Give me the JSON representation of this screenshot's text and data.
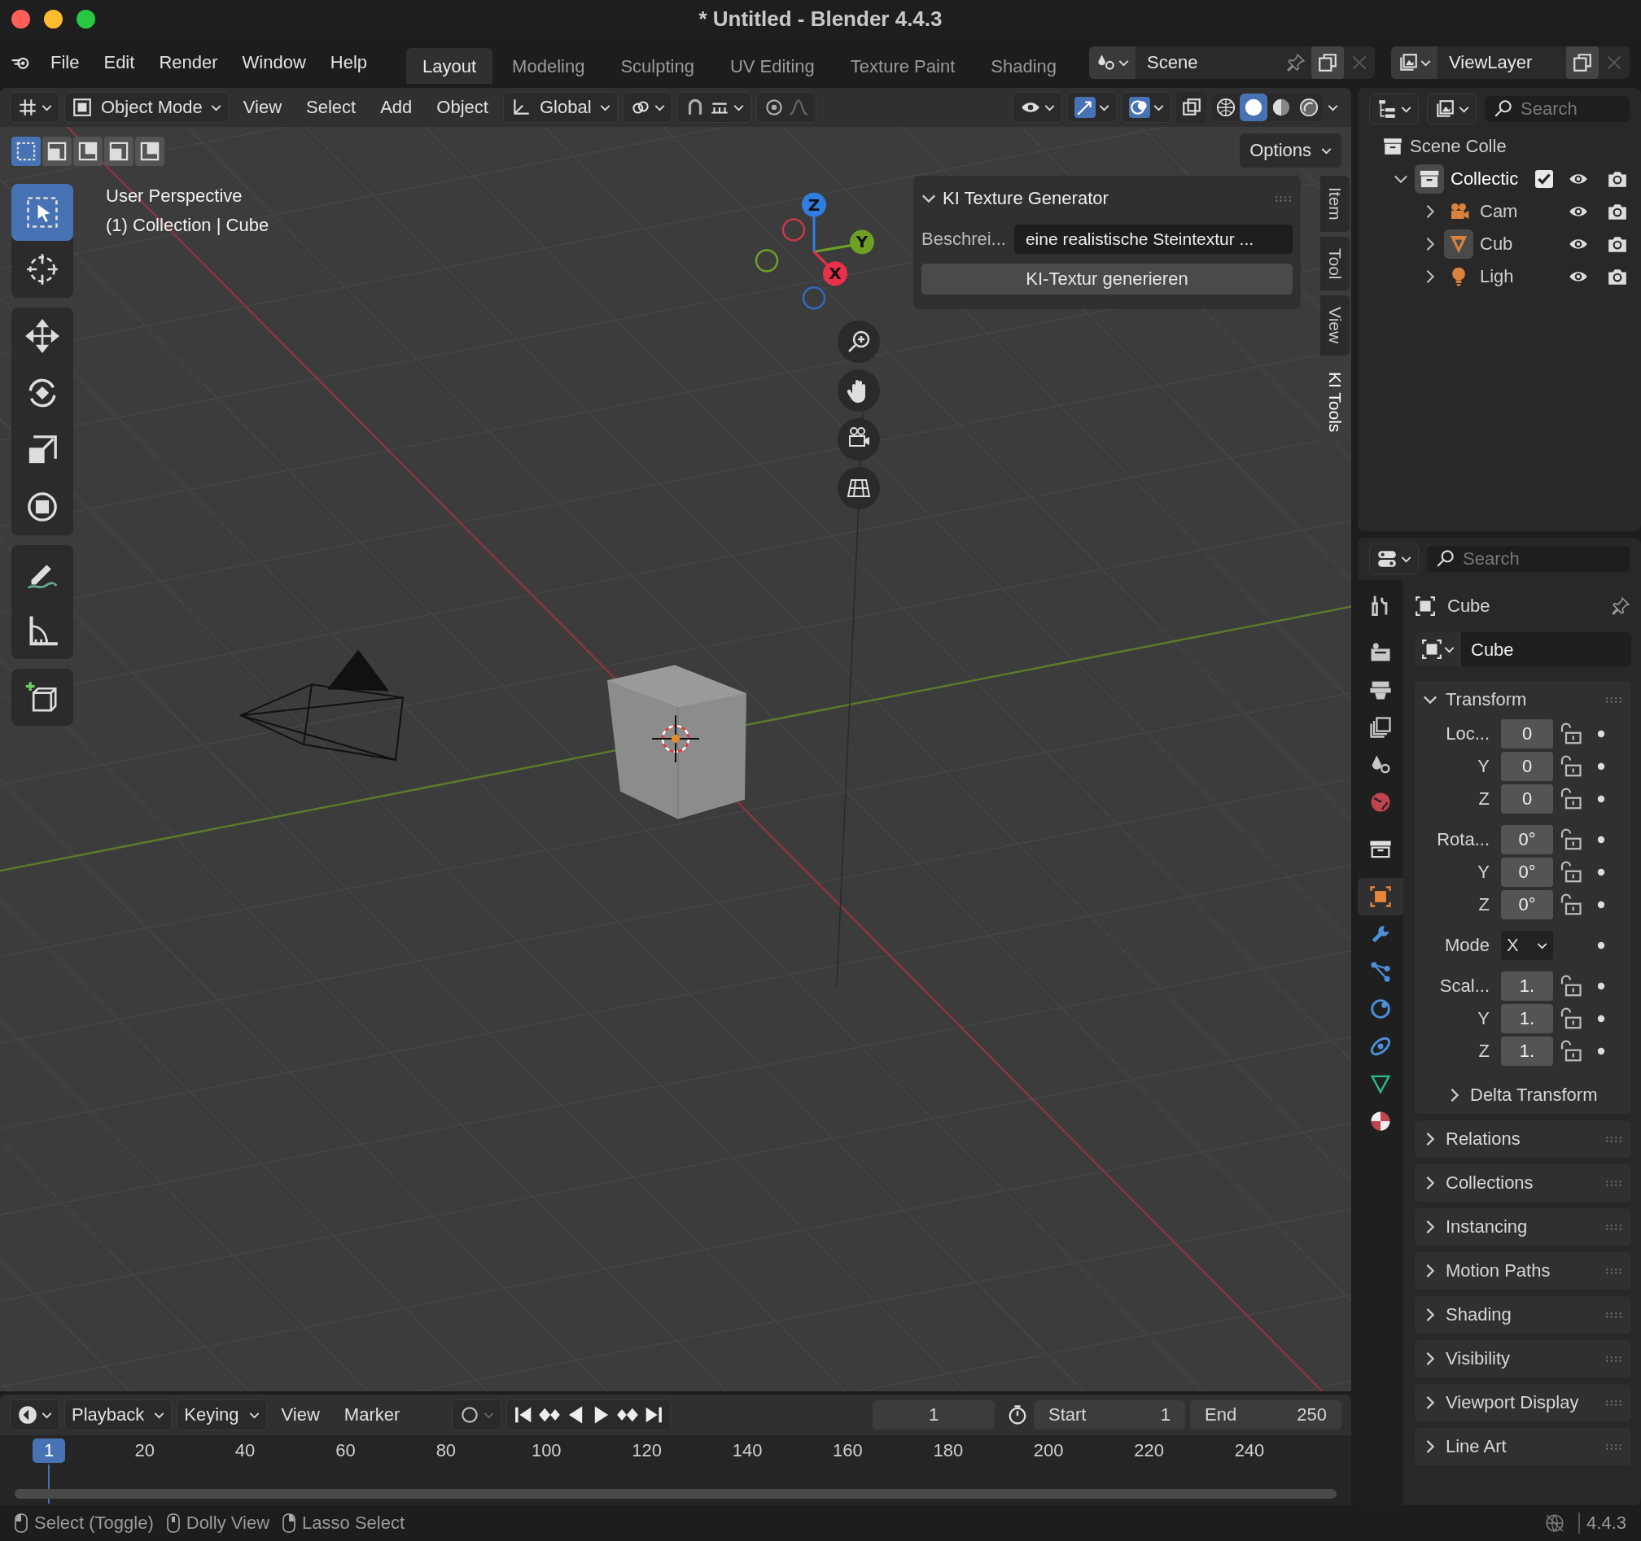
{
  "window": {
    "title": "* Untitled - Blender 4.4.3"
  },
  "menu": [
    "File",
    "Edit",
    "Render",
    "Window",
    "Help"
  ],
  "workspaces": [
    {
      "label": "Layout",
      "selected": true
    },
    {
      "label": "Modeling",
      "selected": false
    },
    {
      "label": "Sculpting",
      "selected": false
    },
    {
      "label": "UV Editing",
      "selected": false
    },
    {
      "label": "Texture Paint",
      "selected": false
    },
    {
      "label": "Shading",
      "selected": false
    }
  ],
  "scene": {
    "name": "Scene"
  },
  "view_layer": {
    "name": "ViewLayer"
  },
  "viewport_header": {
    "mode": "Object Mode",
    "menus": [
      "View",
      "Select",
      "Add",
      "Object"
    ],
    "orientation": "Global",
    "options": "Options"
  },
  "shading_modes": [
    {
      "kind": "wireframe",
      "selected": false
    },
    {
      "kind": "solid",
      "selected": true
    },
    {
      "kind": "material",
      "selected": false
    },
    {
      "kind": "rendered",
      "selected": false
    }
  ],
  "select_modes": [
    {
      "selected": true
    },
    {
      "selected": false
    },
    {
      "selected": false
    },
    {
      "selected": false
    },
    {
      "selected": false
    }
  ],
  "viewport": {
    "perspective": "User Perspective",
    "context": "(1) Collection | Cube"
  },
  "gizmo": {
    "axes": [
      {
        "label": "Z",
        "kind": "z"
      },
      {
        "label": "Y",
        "kind": "y"
      },
      {
        "label": "X",
        "kind": "x"
      }
    ]
  },
  "tool_groups": [
    {
      "tools": [
        {
          "kind": "select",
          "selected": true
        },
        {
          "kind": "cursor",
          "selected": false
        }
      ]
    },
    {
      "tools": [
        {
          "kind": "move",
          "selected": false
        },
        {
          "kind": "rotate",
          "selected": false
        },
        {
          "kind": "scale",
          "selected": false
        },
        {
          "kind": "transform",
          "selected": false
        }
      ]
    },
    {
      "tools": [
        {
          "kind": "annotate",
          "selected": false
        },
        {
          "kind": "measure",
          "selected": false
        }
      ]
    },
    {
      "tools": [
        {
          "kind": "add-cube",
          "selected": false
        }
      ]
    }
  ],
  "sidebar_tabs": [
    {
      "label": "Item",
      "selected": false
    },
    {
      "label": "Tool",
      "selected": false
    },
    {
      "label": "View",
      "selected": false
    },
    {
      "label": "KI Tools",
      "selected": true
    }
  ],
  "ki_panel": {
    "title": "KI Texture Generator",
    "expanded": true,
    "field_label": "Beschrei...",
    "field_value": "eine realistische Steintextur ...",
    "button": "KI-Textur generieren"
  },
  "outliner": {
    "search_placeholder": "Search",
    "tree": [
      {
        "label": "Scene Colle",
        "kind": "scene",
        "children": [
          {
            "label": "Collectic",
            "kind": "collection",
            "active": true,
            "expanded": true,
            "checked": true,
            "children": [
              {
                "label": "Cam",
                "kind": "camera",
                "active": false,
                "expanded": false
              },
              {
                "label": "Cub",
                "kind": "mesh",
                "active": true,
                "expanded": false
              },
              {
                "label": "Ligh",
                "kind": "light",
                "active": false,
                "expanded": false
              }
            ]
          }
        ]
      }
    ]
  },
  "properties": {
    "search_placeholder": "Search",
    "tabs": [
      {
        "kind": "tool",
        "selected": false
      },
      {
        "kind": "render",
        "selected": false
      },
      {
        "kind": "output",
        "selected": false
      },
      {
        "kind": "view-layer",
        "selected": false
      },
      {
        "kind": "scene",
        "selected": false
      },
      {
        "kind": "world",
        "selected": false
      },
      {
        "kind": "collection",
        "selected": false
      },
      {
        "kind": "object",
        "selected": true
      },
      {
        "kind": "modifiers",
        "selected": false
      },
      {
        "kind": "particles",
        "selected": false
      },
      {
        "kind": "physics",
        "selected": false
      },
      {
        "kind": "constraints",
        "selected": false
      },
      {
        "kind": "data",
        "selected": false
      },
      {
        "kind": "material",
        "selected": false
      }
    ],
    "object_name": "Cube",
    "datablock": "Cube",
    "transform": {
      "title": "Transform",
      "expanded": true,
      "groups": [
        {
          "rows": [
            {
              "kind": "field",
              "label": "Loc...",
              "value": "0"
            },
            {
              "kind": "field",
              "label": "Y",
              "value": "0"
            },
            {
              "kind": "field",
              "label": "Z",
              "value": "0"
            }
          ]
        },
        {
          "rows": [
            {
              "kind": "field",
              "label": "Rota...",
              "value": "0°"
            },
            {
              "kind": "field",
              "label": "Y",
              "value": "0°"
            },
            {
              "kind": "field",
              "label": "Z",
              "value": "0°"
            }
          ]
        },
        {
          "rows": [
            {
              "kind": "dropdown",
              "label": "Mode",
              "value": "X"
            }
          ]
        },
        {
          "rows": [
            {
              "kind": "field",
              "label": "Scal...",
              "value": "1."
            },
            {
              "kind": "field",
              "label": "Y",
              "value": "1."
            },
            {
              "kind": "field",
              "label": "Z",
              "value": "1."
            }
          ]
        }
      ],
      "subpanel": "Delta Transform"
    },
    "panels": [
      "Relations",
      "Collections",
      "Instancing",
      "Motion Paths",
      "Shading",
      "Visibility",
      "Viewport Display",
      "Line Art"
    ]
  },
  "timeline": {
    "menus": [
      {
        "label": "Playback",
        "dropdown": true
      },
      {
        "label": "Keying",
        "dropdown": true
      },
      {
        "label": "View",
        "dropdown": false
      },
      {
        "label": "Marker",
        "dropdown": false
      }
    ],
    "current_frame": "1",
    "start_label": "Start",
    "start": "1",
    "end_label": "End",
    "end": "250",
    "playhead": "1",
    "ruler": [
      "20",
      "40",
      "60",
      "80",
      "100",
      "120",
      "140",
      "160",
      "180",
      "200",
      "220",
      "240"
    ]
  },
  "status_bar": {
    "hints": [
      "Select (Toggle)",
      "Dolly View",
      "Lasso Select"
    ],
    "version": "4.4.3"
  }
}
